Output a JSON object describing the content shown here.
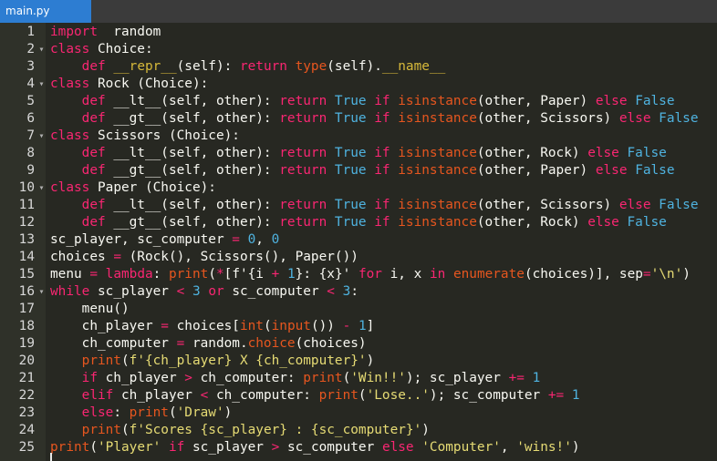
{
  "tab": {
    "filename": "main.py"
  },
  "colors": {
    "background": "#272822",
    "gutter": "#2f3129",
    "tab_active": "#2d7dd2",
    "keyword": "#f92672",
    "builtin": "#e6561f",
    "constant": "#4fb3e0",
    "string": "#e6db74"
  },
  "lines": [
    {
      "n": "1",
      "fold": "",
      "tokens": [
        [
          "k",
          "import"
        ],
        [
          "",
          "  random"
        ]
      ]
    },
    {
      "n": "2",
      "fold": "▾",
      "tokens": [
        [
          "d",
          "class"
        ],
        [
          "",
          " Choice:"
        ]
      ]
    },
    {
      "n": "3",
      "fold": "",
      "tokens": [
        [
          "",
          "    "
        ],
        [
          "d",
          "def"
        ],
        [
          "",
          " "
        ],
        [
          "m",
          "__repr__"
        ],
        [
          "",
          "(self): "
        ],
        [
          "k",
          "return"
        ],
        [
          "",
          " "
        ],
        [
          "b",
          "type"
        ],
        [
          "",
          "(self)."
        ],
        [
          "m",
          "__name__"
        ]
      ]
    },
    {
      "n": "4",
      "fold": "▾",
      "tokens": [
        [
          "d",
          "class"
        ],
        [
          "",
          " Rock (Choice):"
        ]
      ]
    },
    {
      "n": "5",
      "fold": "",
      "tokens": [
        [
          "",
          "    "
        ],
        [
          "d",
          "def"
        ],
        [
          "",
          " __lt__(self, other): "
        ],
        [
          "k",
          "return"
        ],
        [
          "",
          " "
        ],
        [
          "n",
          "True"
        ],
        [
          "",
          " "
        ],
        [
          "k",
          "if"
        ],
        [
          "",
          " "
        ],
        [
          "b",
          "isinstance"
        ],
        [
          "",
          "(other, Paper) "
        ],
        [
          "k",
          "else"
        ],
        [
          "",
          " "
        ],
        [
          "n",
          "False"
        ]
      ]
    },
    {
      "n": "6",
      "fold": "",
      "tokens": [
        [
          "",
          "    "
        ],
        [
          "d",
          "def"
        ],
        [
          "",
          " __gt__(self, other): "
        ],
        [
          "k",
          "return"
        ],
        [
          "",
          " "
        ],
        [
          "n",
          "True"
        ],
        [
          "",
          " "
        ],
        [
          "k",
          "if"
        ],
        [
          "",
          " "
        ],
        [
          "b",
          "isinstance"
        ],
        [
          "",
          "(other, Scissors) "
        ],
        [
          "k",
          "else"
        ],
        [
          "",
          " "
        ],
        [
          "n",
          "False"
        ]
      ]
    },
    {
      "n": "7",
      "fold": "▾",
      "tokens": [
        [
          "d",
          "class"
        ],
        [
          "",
          " Scissors (Choice):"
        ]
      ]
    },
    {
      "n": "8",
      "fold": "",
      "tokens": [
        [
          "",
          "    "
        ],
        [
          "d",
          "def"
        ],
        [
          "",
          " __lt__(self, other): "
        ],
        [
          "k",
          "return"
        ],
        [
          "",
          " "
        ],
        [
          "n",
          "True"
        ],
        [
          "",
          " "
        ],
        [
          "k",
          "if"
        ],
        [
          "",
          " "
        ],
        [
          "b",
          "isinstance"
        ],
        [
          "",
          "(other, Rock) "
        ],
        [
          "k",
          "else"
        ],
        [
          "",
          " "
        ],
        [
          "n",
          "False"
        ]
      ]
    },
    {
      "n": "9",
      "fold": "",
      "tokens": [
        [
          "",
          "    "
        ],
        [
          "d",
          "def"
        ],
        [
          "",
          " __gt__(self, other): "
        ],
        [
          "k",
          "return"
        ],
        [
          "",
          " "
        ],
        [
          "n",
          "True"
        ],
        [
          "",
          " "
        ],
        [
          "k",
          "if"
        ],
        [
          "",
          " "
        ],
        [
          "b",
          "isinstance"
        ],
        [
          "",
          "(other, Paper) "
        ],
        [
          "k",
          "else"
        ],
        [
          "",
          " "
        ],
        [
          "n",
          "False"
        ]
      ]
    },
    {
      "n": "10",
      "fold": "▾",
      "tokens": [
        [
          "d",
          "class"
        ],
        [
          "",
          " Paper (Choice):"
        ]
      ]
    },
    {
      "n": "11",
      "fold": "",
      "tokens": [
        [
          "",
          "    "
        ],
        [
          "d",
          "def"
        ],
        [
          "",
          " __lt__(self, other): "
        ],
        [
          "k",
          "return"
        ],
        [
          "",
          " "
        ],
        [
          "n",
          "True"
        ],
        [
          "",
          " "
        ],
        [
          "k",
          "if"
        ],
        [
          "",
          " "
        ],
        [
          "b",
          "isinstance"
        ],
        [
          "",
          "(other, Scissors) "
        ],
        [
          "k",
          "else"
        ],
        [
          "",
          " "
        ],
        [
          "n",
          "False"
        ]
      ]
    },
    {
      "n": "12",
      "fold": "",
      "tokens": [
        [
          "",
          "    "
        ],
        [
          "d",
          "def"
        ],
        [
          "",
          " __gt__(self, other): "
        ],
        [
          "k",
          "return"
        ],
        [
          "",
          " "
        ],
        [
          "n",
          "True"
        ],
        [
          "",
          " "
        ],
        [
          "k",
          "if"
        ],
        [
          "",
          " "
        ],
        [
          "b",
          "isinstance"
        ],
        [
          "",
          "(other, Rock) "
        ],
        [
          "k",
          "else"
        ],
        [
          "",
          " "
        ],
        [
          "n",
          "False"
        ]
      ]
    },
    {
      "n": "13",
      "fold": "",
      "tokens": [
        [
          "",
          "sc_player, sc_computer "
        ],
        [
          "k",
          "="
        ],
        [
          "",
          " "
        ],
        [
          "n",
          "0"
        ],
        [
          "",
          ", "
        ],
        [
          "n",
          "0"
        ]
      ]
    },
    {
      "n": "14",
      "fold": "",
      "tokens": [
        [
          "",
          "choices "
        ],
        [
          "k",
          "="
        ],
        [
          "",
          " (Rock(), Scissors(), Paper())"
        ]
      ]
    },
    {
      "n": "15",
      "fold": "",
      "tokens": [
        [
          "",
          "menu "
        ],
        [
          "k",
          "="
        ],
        [
          "",
          " "
        ],
        [
          "d",
          "lambda"
        ],
        [
          "",
          ": "
        ],
        [
          "b",
          "print"
        ],
        [
          "",
          "("
        ],
        [
          "k",
          "*"
        ],
        [
          "",
          "[f'{i "
        ],
        [
          "k",
          "+"
        ],
        [
          "",
          " "
        ],
        [
          "n",
          "1"
        ],
        [
          "",
          "}: {x}' "
        ],
        [
          "k",
          "for"
        ],
        [
          "",
          " i, x "
        ],
        [
          "k",
          "in"
        ],
        [
          "",
          " "
        ],
        [
          "b",
          "enumerate"
        ],
        [
          "",
          "(choices)], sep"
        ],
        [
          "k",
          "="
        ],
        [
          "s",
          "'\\n'"
        ],
        [
          "",
          ")"
        ]
      ]
    },
    {
      "n": "16",
      "fold": "▾",
      "tokens": [
        [
          "k",
          "while"
        ],
        [
          "",
          " sc_player "
        ],
        [
          "k",
          "<"
        ],
        [
          "",
          " "
        ],
        [
          "n",
          "3"
        ],
        [
          "",
          " "
        ],
        [
          "k",
          "or"
        ],
        [
          "",
          " sc_computer "
        ],
        [
          "k",
          "<"
        ],
        [
          "",
          " "
        ],
        [
          "n",
          "3"
        ],
        [
          "",
          ":"
        ]
      ]
    },
    {
      "n": "17",
      "fold": "",
      "tokens": [
        [
          "",
          "    menu()"
        ]
      ]
    },
    {
      "n": "18",
      "fold": "",
      "tokens": [
        [
          "",
          "    ch_player "
        ],
        [
          "k",
          "="
        ],
        [
          "",
          " choices["
        ],
        [
          "b",
          "int"
        ],
        [
          "",
          "("
        ],
        [
          "b",
          "input"
        ],
        [
          "",
          "()) "
        ],
        [
          "k",
          "-"
        ],
        [
          "",
          " "
        ],
        [
          "n",
          "1"
        ],
        [
          "",
          "]"
        ]
      ]
    },
    {
      "n": "19",
      "fold": "",
      "tokens": [
        [
          "",
          "    ch_computer "
        ],
        [
          "k",
          "="
        ],
        [
          "",
          " random."
        ],
        [
          "b",
          "choice"
        ],
        [
          "",
          "(choices)"
        ]
      ]
    },
    {
      "n": "20",
      "fold": "",
      "tokens": [
        [
          "",
          "    "
        ],
        [
          "b",
          "print"
        ],
        [
          "",
          "("
        ],
        [
          "s",
          "f'{ch_player} X {ch_computer}'"
        ],
        [
          "",
          ")"
        ]
      ]
    },
    {
      "n": "21",
      "fold": "",
      "tokens": [
        [
          "",
          "    "
        ],
        [
          "k",
          "if"
        ],
        [
          "",
          " ch_player "
        ],
        [
          "k",
          ">"
        ],
        [
          "",
          " ch_computer: "
        ],
        [
          "b",
          "print"
        ],
        [
          "",
          "("
        ],
        [
          "s",
          "'Win!!'"
        ],
        [
          "",
          "); sc_player "
        ],
        [
          "k",
          "+="
        ],
        [
          "",
          " "
        ],
        [
          "n",
          "1"
        ]
      ]
    },
    {
      "n": "22",
      "fold": "",
      "tokens": [
        [
          "",
          "    "
        ],
        [
          "k",
          "elif"
        ],
        [
          "",
          " ch_player "
        ],
        [
          "k",
          "<"
        ],
        [
          "",
          " ch_computer: "
        ],
        [
          "b",
          "print"
        ],
        [
          "",
          "("
        ],
        [
          "s",
          "'Lose..'"
        ],
        [
          "",
          "); sc_computer "
        ],
        [
          "k",
          "+="
        ],
        [
          "",
          " "
        ],
        [
          "n",
          "1"
        ]
      ]
    },
    {
      "n": "23",
      "fold": "",
      "tokens": [
        [
          "",
          "    "
        ],
        [
          "k",
          "else"
        ],
        [
          "",
          ": "
        ],
        [
          "b",
          "print"
        ],
        [
          "",
          "("
        ],
        [
          "s",
          "'Draw'"
        ],
        [
          "",
          ")"
        ]
      ]
    },
    {
      "n": "24",
      "fold": "",
      "tokens": [
        [
          "",
          "    "
        ],
        [
          "b",
          "print"
        ],
        [
          "",
          "("
        ],
        [
          "s",
          "f'Scores {sc_player} : {sc_computer}'"
        ],
        [
          "",
          ")"
        ]
      ]
    },
    {
      "n": "25",
      "fold": "",
      "tokens": [
        [
          "b",
          "print"
        ],
        [
          "",
          "("
        ],
        [
          "s",
          "'Player'"
        ],
        [
          "",
          " "
        ],
        [
          "k",
          "if"
        ],
        [
          "",
          " sc_player "
        ],
        [
          "k",
          ">"
        ],
        [
          "",
          " sc_computer "
        ],
        [
          "k",
          "else"
        ],
        [
          "",
          " "
        ],
        [
          "s",
          "'Computer'"
        ],
        [
          "",
          ", "
        ],
        [
          "s",
          "'wins!'"
        ],
        [
          "",
          ")"
        ]
      ]
    }
  ]
}
